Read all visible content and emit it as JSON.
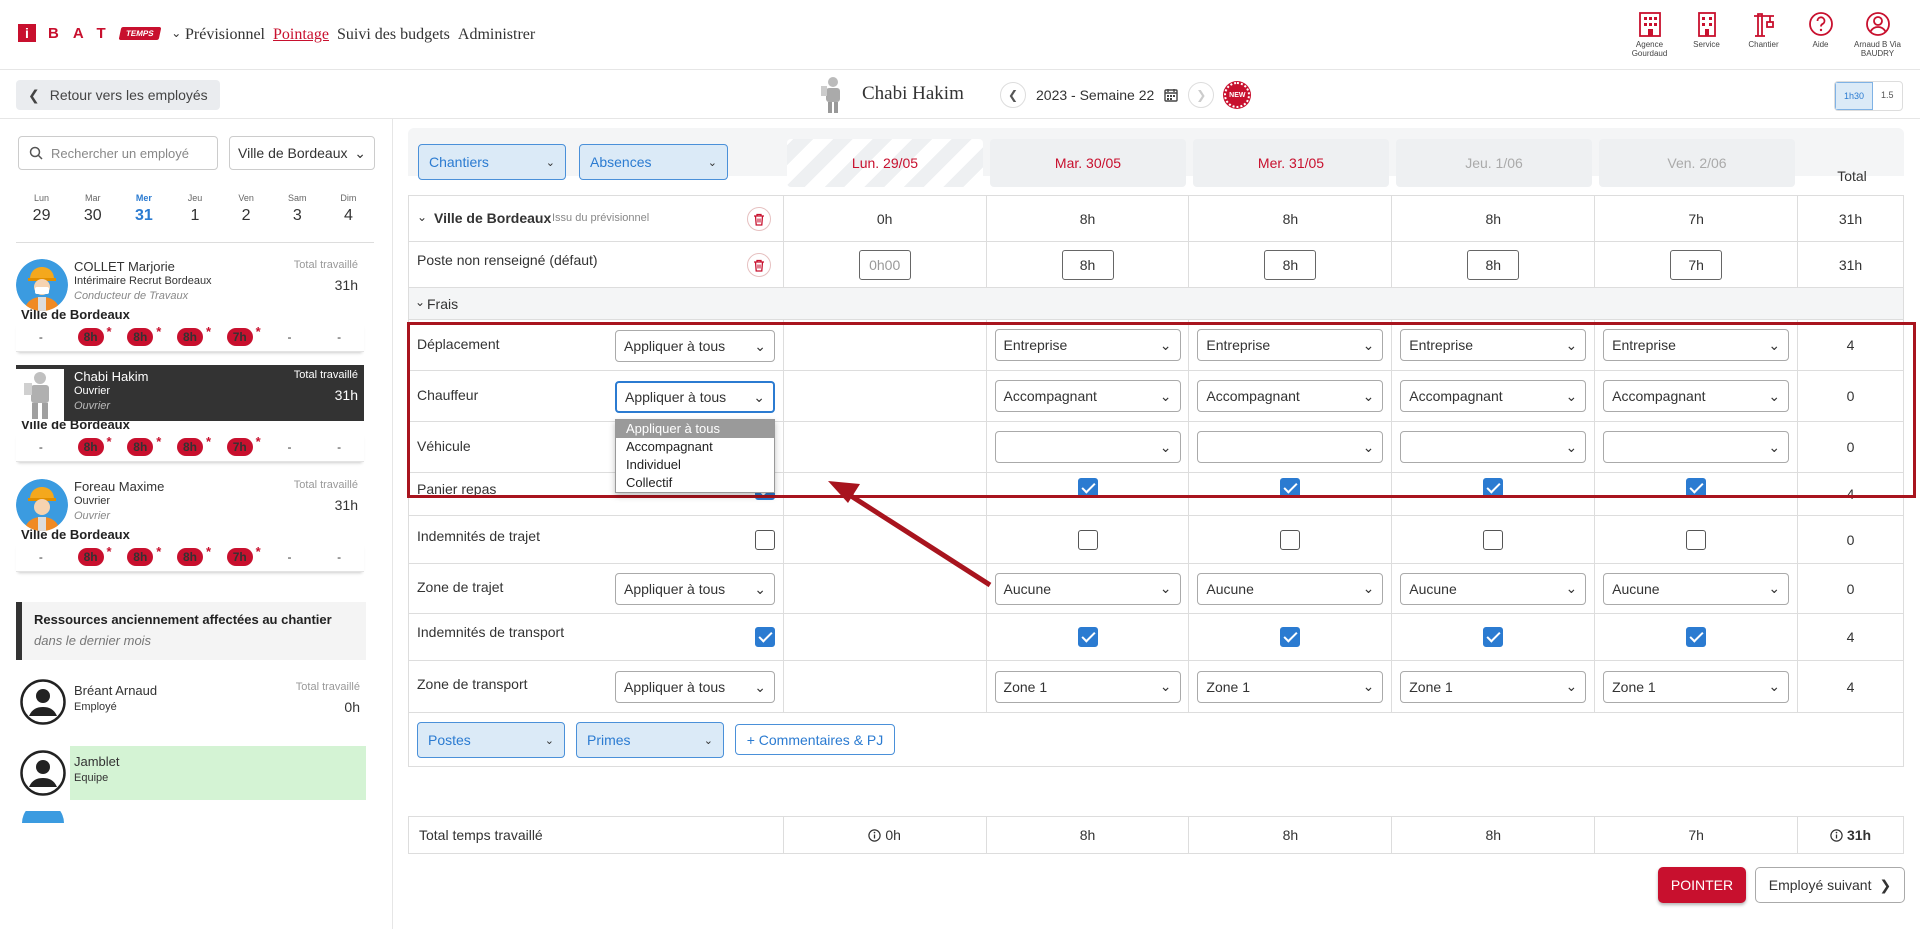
{
  "app": {
    "logo_i": "i",
    "logo_bat": "BAT",
    "logo_temps": "TEMPS",
    "nav": [
      "Prévisionnel",
      "Pointage",
      "Suivi des budgets",
      "Administrer"
    ],
    "active_nav": "Pointage",
    "top_icons": [
      {
        "icon": "building-icon",
        "label": "Agence Gourdaud"
      },
      {
        "icon": "service-building-icon",
        "label": "Service"
      },
      {
        "icon": "crane-icon",
        "label": "Chantier"
      },
      {
        "icon": "help-icon",
        "label": "Aide"
      },
      {
        "icon": "user-icon",
        "label": "Arnaud B Via BAUDRY"
      }
    ]
  },
  "header": {
    "back_label": "Retour vers les employés",
    "employee_name": "Chabi Hakim",
    "week_label": "2023 - Semaine 22",
    "new_badge": "NEW",
    "toggle": [
      "1h30",
      "1.5"
    ]
  },
  "sidebar": {
    "search_placeholder": "Rechercher un employé",
    "city_filter": "Ville de Bordeaux",
    "days": [
      {
        "label": "Lun",
        "num": "29"
      },
      {
        "label": "Mar",
        "num": "30"
      },
      {
        "label": "Mer",
        "num": "31"
      },
      {
        "label": "Jeu",
        "num": "1"
      },
      {
        "label": "Ven",
        "num": "2"
      },
      {
        "label": "Sam",
        "num": "3"
      },
      {
        "label": "Dim",
        "num": "4"
      }
    ],
    "employees": [
      {
        "name": "COLLET Marjorie",
        "role": "Intérimaire Recrut Bordeaux",
        "sub": "Conducteur de Travaux",
        "total_label": "Total travaillé",
        "total": "31h",
        "city": "Ville de Bordeaux",
        "hours": [
          "-",
          "8h",
          "8h",
          "8h",
          "7h",
          "-",
          "-"
        ]
      },
      {
        "name": "Chabi Hakim",
        "role": "Ouvrier",
        "sub": "Ouvrier",
        "total_label": "Total travaillé",
        "total": "31h",
        "city": "Ville de Bordeaux",
        "hours": [
          "-",
          "8h",
          "8h",
          "8h",
          "7h",
          "-",
          "-"
        ]
      },
      {
        "name": "Foreau Maxime",
        "role": "Ouvrier",
        "sub": "Ouvrier",
        "total_label": "Total travaillé",
        "total": "31h",
        "city": "Ville de Bordeaux",
        "hours": [
          "-",
          "8h",
          "8h",
          "8h",
          "7h",
          "-",
          "-"
        ]
      }
    ],
    "resources_title": "Ressources anciennement affectées au chantier",
    "resources_sub": "dans le dernier mois",
    "former": [
      {
        "name": "Bréant Arnaud",
        "role": "Employé",
        "total_label": "Total travaillé",
        "total": "0h"
      },
      {
        "name": "Jamblet",
        "role": "Equipe"
      }
    ]
  },
  "main": {
    "filters": [
      "Chantiers",
      "Absences"
    ],
    "days": [
      "Lun. 29/05",
      "Mar. 30/05",
      "Mer. 31/05",
      "Jeu. 1/06",
      "Ven. 2/06"
    ],
    "total_label": "Total",
    "site_row": {
      "title": "Ville de Bordeaux",
      "subtitle": "Issu du prévisionnel",
      "values": [
        "0h",
        "8h",
        "8h",
        "8h",
        "7h"
      ],
      "total": "31h"
    },
    "poste_row": {
      "label": "Poste non renseigné (défaut)",
      "inputs": [
        "0h00",
        "8h",
        "8h",
        "8h",
        "7h"
      ],
      "total": "31h"
    },
    "frais_label": "Frais",
    "frais": {
      "deplacement": {
        "label": "Déplacement",
        "apply": "Appliquer à tous",
        "values": [
          "Entreprise",
          "Entreprise",
          "Entreprise",
          "Entreprise"
        ],
        "total": "4"
      },
      "chauffeur": {
        "label": "Chauffeur",
        "apply": "Appliquer à tous",
        "values": [
          "Accompagnant",
          "Accompagnant",
          "Accompagnant",
          "Accompagnant"
        ],
        "total": "0"
      },
      "vehicule": {
        "label": "Véhicule",
        "total": "0"
      },
      "panier": {
        "label": "Panier repas",
        "total": "4"
      },
      "indemnites_trajet": {
        "label": "Indemnités de trajet",
        "total": "0"
      },
      "zone_trajet": {
        "label": "Zone de trajet",
        "apply": "Appliquer à tous",
        "values": [
          "Aucune",
          "Aucune",
          "Aucune",
          "Aucune"
        ],
        "total": "0"
      },
      "indemnites_transport": {
        "label": "Indemnités de transport",
        "total": "4"
      },
      "zone_transport": {
        "label": "Zone de transport",
        "apply": "Appliquer à tous",
        "values": [
          "Zone 1",
          "Zone 1",
          "Zone 1",
          "Zone 1"
        ],
        "total": "4"
      }
    },
    "dropdown_options": [
      "Appliquer à tous",
      "Accompagnant",
      "Individuel",
      "Collectif"
    ],
    "bottom_buttons": {
      "postes": "Postes",
      "primes": "Primes",
      "comments": "+ Commentaires & PJ"
    },
    "total_row": {
      "label": "Total temps travaillé",
      "values": [
        "0h",
        "8h",
        "8h",
        "8h",
        "7h"
      ],
      "total": "31h"
    },
    "pointer_label": "POINTER",
    "next_label": "Employé suivant"
  },
  "colors": {
    "brand_red": "#c8102e",
    "accent_blue": "#2b7bd1",
    "annotation_red": "#a8141e"
  }
}
